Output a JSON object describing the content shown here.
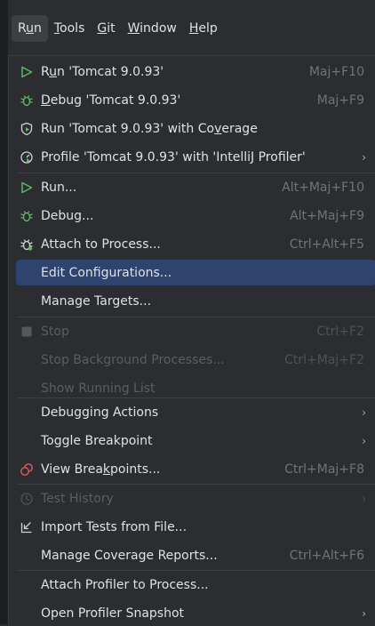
{
  "menubar": {
    "items": [
      {
        "label": "Run",
        "pre": "R",
        "u": "u",
        "post": "n"
      },
      {
        "label": "Tools",
        "pre": "",
        "u": "T",
        "post": "ools"
      },
      {
        "label": "Git",
        "pre": "",
        "u": "G",
        "post": "it"
      },
      {
        "label": "Window",
        "pre": "",
        "u": "W",
        "post": "indow"
      },
      {
        "label": "Help",
        "pre": "",
        "u": "H",
        "post": "elp"
      }
    ]
  },
  "menu": {
    "items": [
      {
        "pre": "R",
        "u": "u",
        "post": "n 'Tomcat 9.0.93'",
        "shortcut": "Maj+F10",
        "icon": "run-triangle-icon"
      },
      {
        "pre": "",
        "u": "D",
        "post": "ebug 'Tomcat 9.0.93'",
        "shortcut": "Maj+F9",
        "icon": "debug-bug-icon"
      },
      {
        "pre": "Run 'Tomcat 9.0.93' with Co",
        "u": "v",
        "post": "erage",
        "shortcut": "",
        "icon": "coverage-shield-icon"
      },
      {
        "pre": "Profile 'Tomcat 9.0.93' with 'IntelliJ Profiler'",
        "u": "",
        "post": "",
        "shortcut": "",
        "icon": "profiler-gauge-icon"
      },
      {
        "pre": "Run...",
        "u": "",
        "post": "",
        "shortcut": "Alt+Maj+F10",
        "icon": "run-triangle-icon"
      },
      {
        "pre": "Debug...",
        "u": "",
        "post": "",
        "shortcut": "Alt+Maj+F9",
        "icon": "debug-bug-icon"
      },
      {
        "pre": "Attach to Process...",
        "u": "",
        "post": "",
        "shortcut": "Ctrl+Alt+F5",
        "icon": "attach-bug-icon"
      },
      {
        "pre": "Edit Confi",
        "u": "g",
        "post": "urations...",
        "shortcut": "",
        "icon": ""
      },
      {
        "pre": "Manage Targets...",
        "u": "",
        "post": "",
        "shortcut": "",
        "icon": ""
      },
      {
        "pre": "Stop",
        "u": "",
        "post": "",
        "shortcut": "Ctrl+F2",
        "icon": "stop-square-icon"
      },
      {
        "pre": "Stop Background Processes...",
        "u": "",
        "post": "",
        "shortcut": "Ctrl+Maj+F2",
        "icon": ""
      },
      {
        "pre": "Show Running List",
        "u": "",
        "post": "",
        "shortcut": "",
        "icon": ""
      },
      {
        "pre": "Debugging Actions",
        "u": "",
        "post": "",
        "shortcut": "",
        "icon": ""
      },
      {
        "pre": "Toggle Breakpoint",
        "u": "",
        "post": "",
        "shortcut": "",
        "icon": ""
      },
      {
        "pre": "View Brea",
        "u": "k",
        "post": "points...",
        "shortcut": "Ctrl+Maj+F8",
        "icon": "breakpoints-icon"
      },
      {
        "pre": "Test History",
        "u": "",
        "post": "",
        "shortcut": "",
        "icon": "history-clock-icon"
      },
      {
        "pre": "Import Tests from File...",
        "u": "",
        "post": "",
        "shortcut": "",
        "icon": "import-arrow-icon"
      },
      {
        "pre": "Manage Coverage Reports...",
        "u": "",
        "post": "",
        "shortcut": "Ctrl+Alt+F6",
        "icon": ""
      },
      {
        "pre": "Attach Profiler to Process...",
        "u": "",
        "post": "",
        "shortcut": "",
        "icon": ""
      },
      {
        "pre": "Open Profiler Snapshot",
        "u": "",
        "post": "",
        "shortcut": "",
        "icon": ""
      }
    ]
  },
  "submenu_arrow": "›",
  "colors": {
    "run_green": "#5fb865",
    "debug_green": "#5fb865",
    "breakpoint_red": "#e55765",
    "selection": "#2e436e"
  }
}
